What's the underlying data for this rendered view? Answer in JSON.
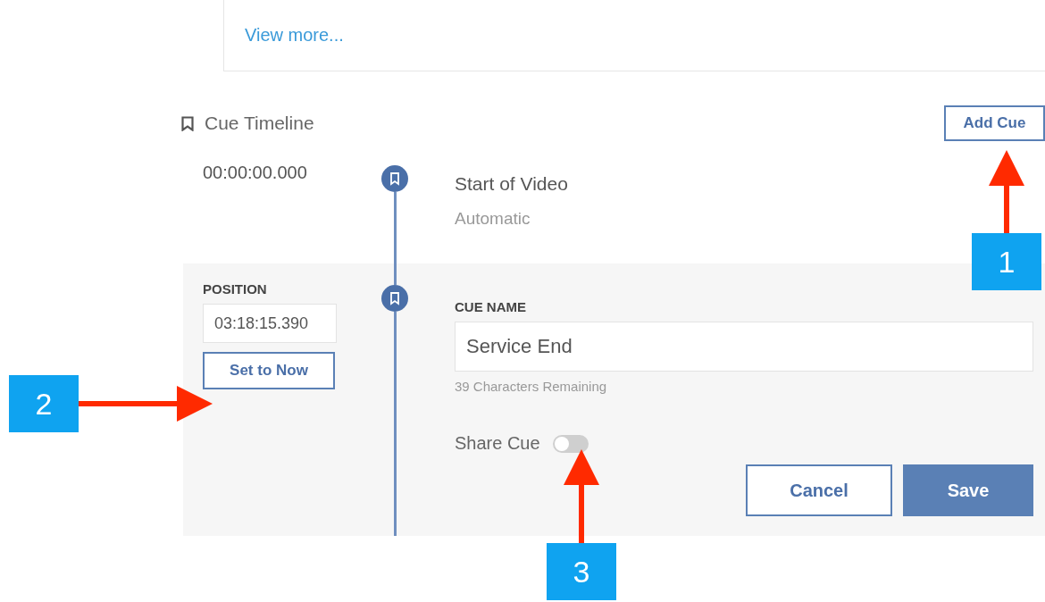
{
  "view_more": {
    "label": "View more..."
  },
  "timeline": {
    "title": "Cue Timeline",
    "add_button": "Add Cue"
  },
  "cues": [
    {
      "time": "00:00:00.000",
      "name": "Start of Video",
      "source": "Automatic"
    }
  ],
  "editor": {
    "position_label": "POSITION",
    "position_value": "03:18:15.390",
    "set_now_button": "Set to Now",
    "name_label": "CUE NAME",
    "name_value": "Service End",
    "remaining": "39 Characters Remaining",
    "share": {
      "label": "Share Cue",
      "on": false
    },
    "cancel_button": "Cancel",
    "save_button": "Save"
  },
  "callouts": [
    {
      "label": "1",
      "kind": "up"
    },
    {
      "label": "2",
      "kind": "right"
    },
    {
      "label": "3",
      "kind": "up"
    }
  ]
}
